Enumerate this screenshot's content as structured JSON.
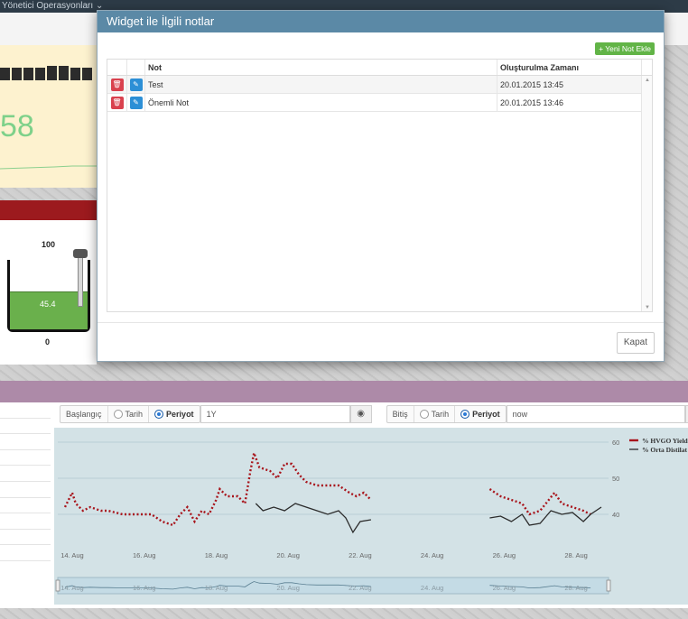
{
  "nav": {
    "menu_label": "Yönetici Operasyonları ⌄"
  },
  "widget1": {
    "value": "58"
  },
  "tank": {
    "max_label": "100",
    "min_label": "0",
    "value_label": "45.4",
    "fill_ratio": 0.454,
    "fill_color": "#6ab04c"
  },
  "controls": {
    "start_label": "Başlangıç",
    "end_label": "Bitiş",
    "date_option": "Tarih",
    "period_option": "Periyot",
    "start_value": "1Y",
    "end_value": "now",
    "apply_icon": "target-icon"
  },
  "chart_data": {
    "type": "line",
    "title": "",
    "x_ticks": [
      "14. Aug",
      "16. Aug",
      "18. Aug",
      "20. Aug",
      "22. Aug",
      "24. Aug",
      "26. Aug",
      "28. Aug"
    ],
    "navigator_ticks": [
      "14. Aug",
      "16. Aug",
      "18. Aug",
      "20. Aug",
      "22. Aug",
      "24. Aug",
      "26. Aug",
      "28. Aug"
    ],
    "y_ticks": [
      "60",
      "50",
      "40"
    ],
    "ylim": [
      32,
      63
    ],
    "series": [
      {
        "name": "% HVGO Yield",
        "color": "#a8141b",
        "style": "dotted",
        "points": [
          [
            13.8,
            42
          ],
          [
            14.0,
            46
          ],
          [
            14.1,
            43
          ],
          [
            14.3,
            41
          ],
          [
            14.5,
            42
          ],
          [
            14.8,
            41
          ],
          [
            15.0,
            41
          ],
          [
            15.4,
            40
          ],
          [
            15.8,
            40
          ],
          [
            16.2,
            40
          ],
          [
            16.5,
            38
          ],
          [
            16.8,
            37
          ],
          [
            17.0,
            40
          ],
          [
            17.2,
            42
          ],
          [
            17.4,
            38
          ],
          [
            17.6,
            41
          ],
          [
            17.8,
            40
          ],
          [
            18.0,
            44
          ],
          [
            18.1,
            47
          ],
          [
            18.3,
            45
          ],
          [
            18.6,
            45
          ],
          [
            18.8,
            43
          ],
          [
            18.95,
            52
          ],
          [
            19.05,
            57
          ],
          [
            19.2,
            53
          ],
          [
            19.5,
            52
          ],
          [
            19.7,
            50
          ],
          [
            19.9,
            54
          ],
          [
            20.1,
            54
          ],
          [
            20.3,
            51
          ],
          [
            20.5,
            49
          ],
          [
            20.8,
            48
          ],
          [
            21.1,
            48
          ],
          [
            21.4,
            48
          ],
          [
            21.7,
            46
          ],
          [
            21.9,
            45
          ],
          [
            22.1,
            46
          ],
          [
            22.3,
            44
          ],
          [
            25.6,
            47
          ],
          [
            25.9,
            45
          ],
          [
            26.2,
            44
          ],
          [
            26.5,
            43
          ],
          [
            26.7,
            40
          ],
          [
            27.0,
            41
          ],
          [
            27.4,
            46
          ],
          [
            27.6,
            43
          ],
          [
            27.9,
            42
          ],
          [
            28.2,
            41
          ],
          [
            28.4,
            40
          ]
        ]
      },
      {
        "name": "% Orta Distilat",
        "color": "#2b2b2b",
        "style": "solid",
        "points": [
          [
            19.1,
            43
          ],
          [
            19.3,
            41
          ],
          [
            19.6,
            42
          ],
          [
            19.9,
            41
          ],
          [
            20.2,
            43
          ],
          [
            20.5,
            42
          ],
          [
            20.8,
            41
          ],
          [
            21.1,
            40
          ],
          [
            21.4,
            41
          ],
          [
            21.6,
            39
          ],
          [
            21.8,
            35
          ],
          [
            22.0,
            38
          ],
          [
            22.3,
            38.5
          ],
          [
            25.6,
            39
          ],
          [
            25.9,
            39.5
          ],
          [
            26.2,
            38
          ],
          [
            26.5,
            40
          ],
          [
            26.7,
            37
          ],
          [
            27.0,
            37.5
          ],
          [
            27.3,
            41
          ],
          [
            27.6,
            40
          ],
          [
            27.9,
            40.5
          ],
          [
            28.2,
            38
          ],
          [
            28.4,
            40
          ],
          [
            28.7,
            42
          ]
        ]
      }
    ],
    "x_range": [
      13.6,
      28.9
    ],
    "legend_position": "top-right",
    "grid": true
  },
  "modal": {
    "title": "Widget ile İlgili notlar",
    "add_button": "+ Yeni Not Ekle",
    "columns": [
      "Not",
      "Oluşturulma Zamanı"
    ],
    "rows": [
      {
        "note": "Test",
        "created": "20.01.2015 13:45"
      },
      {
        "note": "Önemli Not",
        "created": "20.01.2015 13:46"
      }
    ],
    "close_button": "Kapat"
  }
}
